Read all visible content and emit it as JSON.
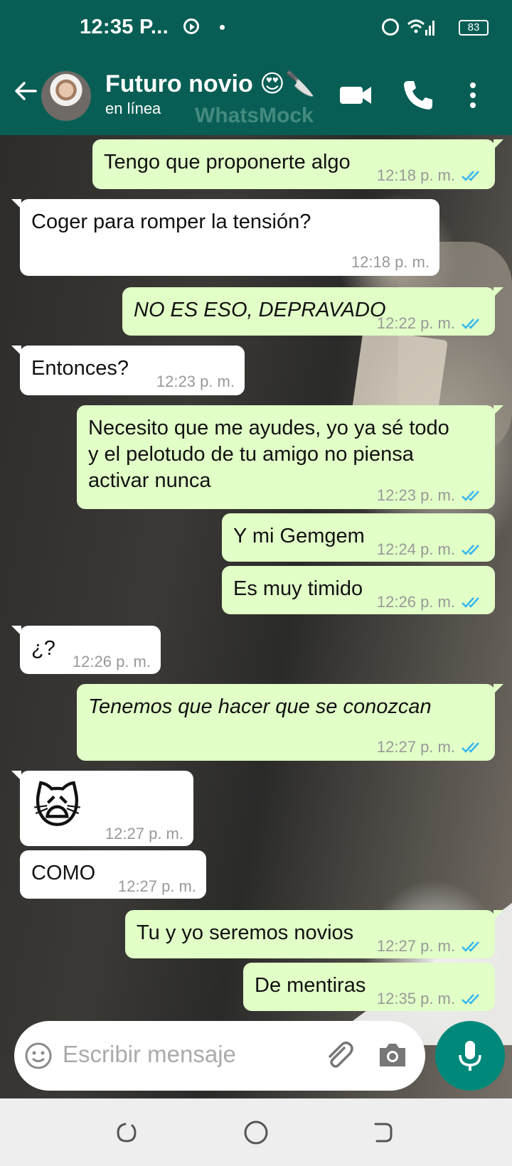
{
  "status_bar": {
    "time": "12:35 P...",
    "battery": "83"
  },
  "header": {
    "contact_name": "Futuro novio 😍🔪",
    "contact_status": "en línea",
    "watermark": "WhatsMock"
  },
  "messages": [
    {
      "dir": "out",
      "text": "Tengo que proponerte algo",
      "time": "12:18 p. m."
    },
    {
      "dir": "in",
      "text": "Coger para romper la tensión?",
      "time": "12:18 p. m."
    },
    {
      "dir": "out",
      "text": "NO ES ESO, DEPRAVADO",
      "time": "12:22 p. m."
    },
    {
      "dir": "in",
      "text": "Entonces?",
      "time": "12:23 p. m."
    },
    {
      "dir": "out",
      "lines": [
        "Necesito que me ayudes, yo ya sé todo",
        "y el pelotudo de tu amigo no piensa",
        "activar nunca"
      ],
      "time": "12:23 p. m."
    },
    {
      "dir": "out",
      "text": "Y mi Gemgem",
      "time": "12:24 p. m."
    },
    {
      "dir": "out",
      "text": "Es muy timido",
      "time": "12:26 p. m."
    },
    {
      "dir": "in",
      "text": "¿?",
      "time": "12:26 p. m."
    },
    {
      "dir": "out",
      "text": "Tenemos que hacer que se conozcan",
      "time": "12:27 p. m."
    },
    {
      "dir": "in",
      "text": "🙀",
      "time": "12:27 p. m."
    },
    {
      "dir": "in",
      "text": "COMO",
      "time": "12:27 p. m."
    },
    {
      "dir": "out",
      "text": "Tu y yo seremos novios",
      "time": "12:27 p. m."
    },
    {
      "dir": "out",
      "text": "De mentiras",
      "time": "12:35 p. m."
    }
  ],
  "composer": {
    "placeholder": "Escribir mensaje"
  },
  "colors": {
    "header": "#085e54",
    "outgoing_bubble": "#e1ffc7",
    "incoming_bubble": "#ffffff",
    "mic_button": "#00897b",
    "read_ticks": "#34b7f1"
  },
  "icons": {
    "back": "arrow-left-icon",
    "video": "video-camera-icon",
    "call": "phone-icon",
    "menu": "more-vert-icon",
    "emoji": "emoji-icon",
    "attach": "paperclip-icon",
    "camera": "camera-icon",
    "mic": "microphone-icon"
  }
}
